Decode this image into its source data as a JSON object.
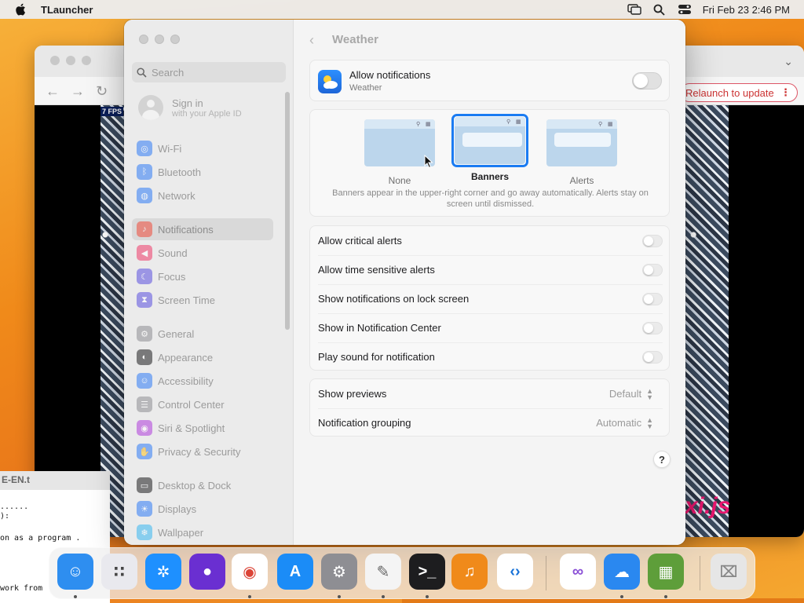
{
  "menubar": {
    "app_name": "TLauncher",
    "datetime": "Fri Feb 23  2:46 PM"
  },
  "browser": {
    "relaunch_label": "Relaunch to update",
    "fps_label": "7 FPS",
    "pixi_logo": "xi.js"
  },
  "terminal": {
    "tab_label": "E-EN.t",
    "lines": [
      "......",
      "):",
      "on as a program .",
      "work from"
    ]
  },
  "settings": {
    "search_placeholder": "Search",
    "signin": {
      "title": "Sign in",
      "subtitle": "with your Apple ID"
    },
    "sidebar": [
      {
        "label": "Wi-Fi",
        "icon": "wifi-icon",
        "color": "#2f7cf6"
      },
      {
        "label": "Bluetooth",
        "icon": "bluetooth-icon",
        "color": "#2f7cf6"
      },
      {
        "label": "Network",
        "icon": "globe-icon",
        "color": "#2f7cf6"
      },
      {
        "label": "Notifications",
        "icon": "bell-icon",
        "color": "#ef4a3a",
        "selected": true
      },
      {
        "label": "Sound",
        "icon": "speaker-icon",
        "color": "#ef3a6a"
      },
      {
        "label": "Focus",
        "icon": "moon-icon",
        "color": "#5b4fe0"
      },
      {
        "label": "Screen Time",
        "icon": "hourglass-icon",
        "color": "#5b4fe0"
      },
      {
        "label": "General",
        "icon": "gear-icon",
        "color": "#8e8e93"
      },
      {
        "label": "Appearance",
        "icon": "appearance-icon",
        "color": "#1d1d1f"
      },
      {
        "label": "Accessibility",
        "icon": "accessibility-icon",
        "color": "#2f7cf6"
      },
      {
        "label": "Control Center",
        "icon": "control-center-icon",
        "color": "#8e8e93"
      },
      {
        "label": "Siri & Spotlight",
        "icon": "siri-icon",
        "color": "#b03cdc"
      },
      {
        "label": "Privacy & Security",
        "icon": "hand-icon",
        "color": "#2f7cf6"
      },
      {
        "label": "Desktop & Dock",
        "icon": "dock-icon",
        "color": "#1d1d1f"
      },
      {
        "label": "Displays",
        "icon": "sun-icon",
        "color": "#2f7cf6"
      },
      {
        "label": "Wallpaper",
        "icon": "wallpaper-icon",
        "color": "#38b6f0"
      }
    ],
    "main": {
      "title": "Weather",
      "allow": {
        "title": "Allow notifications",
        "subtitle": "Weather",
        "on": false
      },
      "styles": [
        {
          "label": "None",
          "selected": false
        },
        {
          "label": "Banners",
          "selected": true
        },
        {
          "label": "Alerts",
          "selected": false
        }
      ],
      "style_description": "Banners appear in the upper-right corner and go away automatically. Alerts stay on screen until dismissed.",
      "toggles": [
        "Allow critical alerts",
        "Allow time sensitive alerts",
        "Show notifications on lock screen",
        "Show in Notification Center",
        "Play sound for notification"
      ],
      "selects": [
        {
          "label": "Show previews",
          "value": "Default"
        },
        {
          "label": "Notification grouping",
          "value": "Automatic"
        }
      ],
      "help": "?"
    }
  },
  "dock": [
    {
      "name": "finder-icon",
      "color": "#2e8ef0",
      "dot": true
    },
    {
      "name": "launchpad-icon",
      "color": "#e9e9ee",
      "dot": false
    },
    {
      "name": "safari-icon",
      "color": "#1e90ff",
      "dot": false
    },
    {
      "name": "firefox-icon",
      "color": "#6a2fd1",
      "dot": false
    },
    {
      "name": "chrome-icon",
      "color": "#ffffff",
      "dot": true
    },
    {
      "name": "app-store-icon",
      "color": "#1b8cf7",
      "dot": false
    },
    {
      "name": "system-settings-icon",
      "color": "#8e8e93",
      "dot": true
    },
    {
      "name": "textedit-icon",
      "color": "#f4f4f4",
      "dot": true
    },
    {
      "name": "terminal-icon",
      "color": "#1d1d1f",
      "dot": true
    },
    {
      "name": "garageband-icon",
      "color": "#f08a1a",
      "dot": false
    },
    {
      "name": "vscode-icon",
      "color": "#ffffff",
      "dot": false
    },
    {
      "name": "visual-studio-icon",
      "color": "#ffffff",
      "dot": false
    },
    {
      "name": "weather-icon",
      "color": "#2a88f0",
      "dot": true
    },
    {
      "name": "minecraft-icon",
      "color": "#5e9e3a",
      "dot": true
    },
    {
      "name": "trash-icon",
      "color": "#e6e6e6",
      "dot": false
    }
  ]
}
